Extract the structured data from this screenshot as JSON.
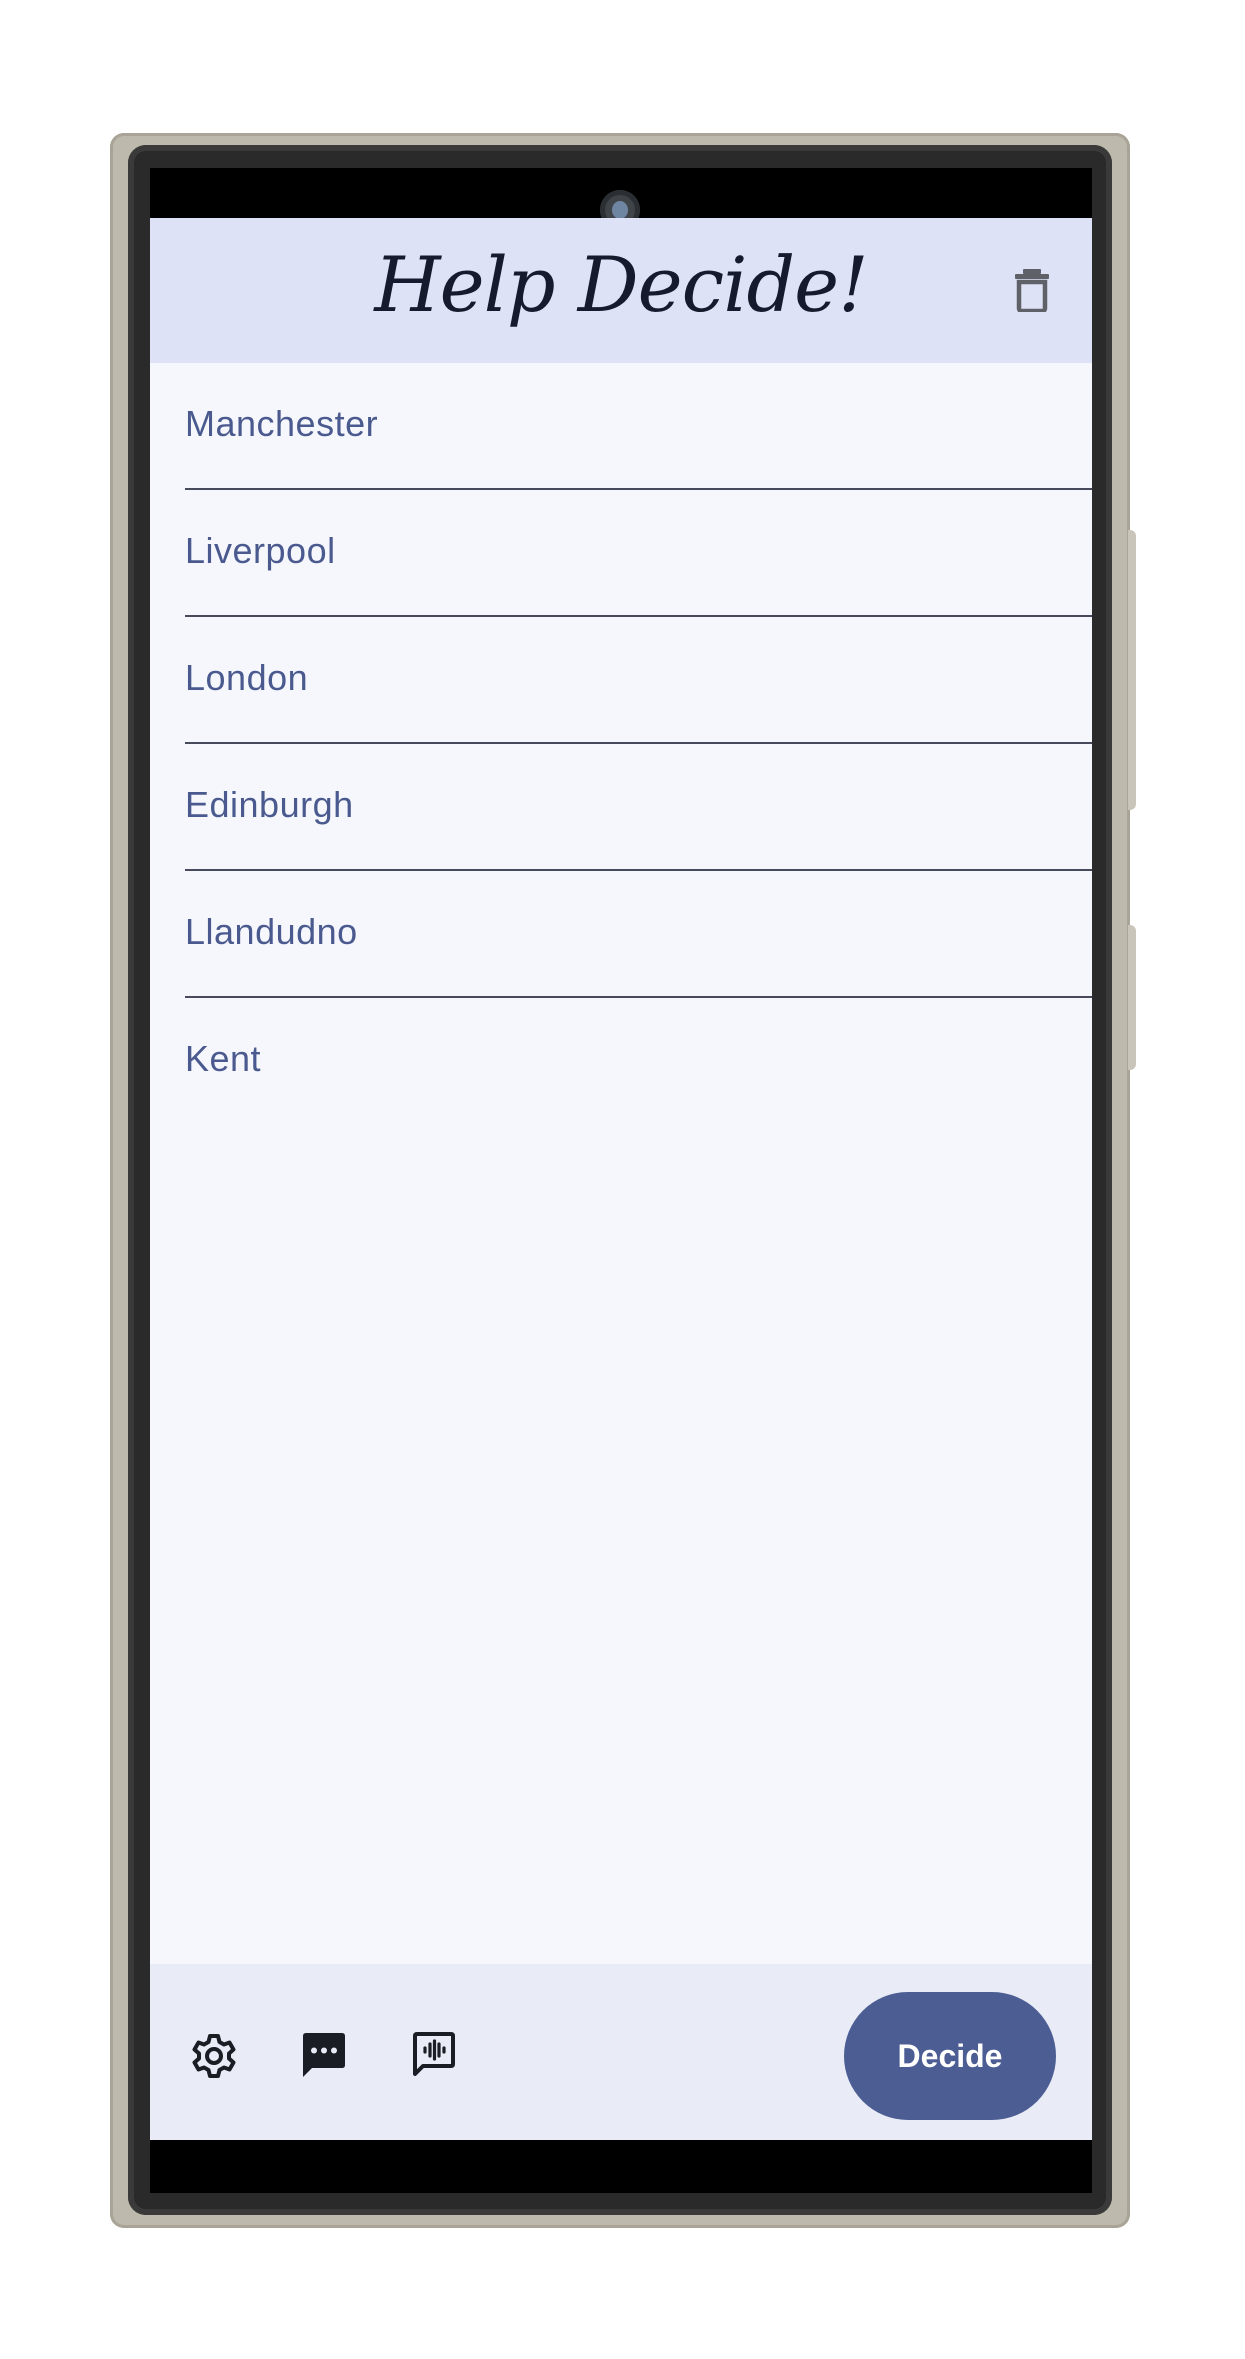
{
  "app": {
    "title": "Help Decide!"
  },
  "options": [
    {
      "label": "Manchester"
    },
    {
      "label": "Liverpool"
    },
    {
      "label": "London"
    },
    {
      "label": "Edinburgh"
    },
    {
      "label": "Llandudno"
    },
    {
      "label": "Kent"
    }
  ],
  "bottom_bar": {
    "decide_label": "Decide",
    "icons": [
      "settings-icon",
      "chat-more-icon",
      "voice-chat-icon"
    ]
  },
  "colors": {
    "header_bg": "#dee2f6",
    "list_bg": "#f6f7fd",
    "item_text": "#4a5a8f",
    "bottom_bar_bg": "#e9ebf6",
    "accent": "#4c5d93"
  }
}
